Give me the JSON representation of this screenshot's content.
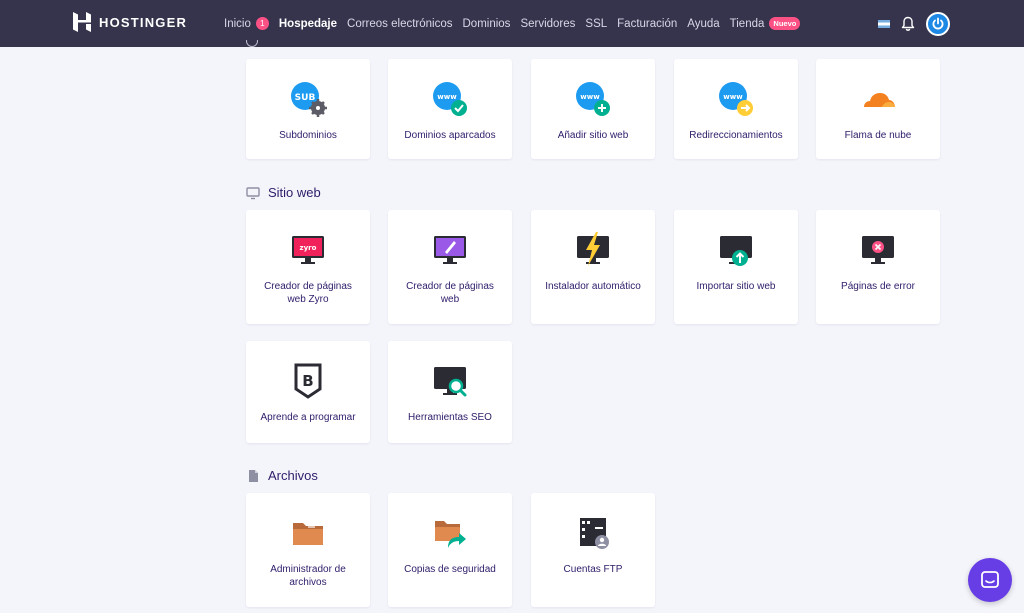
{
  "brand": {
    "name": "HOSTINGER"
  },
  "nav": {
    "items": [
      {
        "label": "Inicio",
        "badge": "1"
      },
      {
        "label": "Hospedaje",
        "active": true
      },
      {
        "label": "Correos electrónicos"
      },
      {
        "label": "Dominios"
      },
      {
        "label": "Servidores"
      },
      {
        "label": "SSL"
      },
      {
        "label": "Facturación"
      },
      {
        "label": "Ayuda"
      },
      {
        "label": "Tienda",
        "tag": "Nuevo"
      }
    ]
  },
  "sections": {
    "dominios": {
      "cards": [
        {
          "label": "Subdominios",
          "icon": "subdomain-icon"
        },
        {
          "label": "Dominios aparcados",
          "icon": "parked-domain-icon"
        },
        {
          "label": "Añadir sitio web",
          "icon": "add-website-icon"
        },
        {
          "label": "Redireccionamientos",
          "icon": "redirect-icon"
        },
        {
          "label": "Flama de nube",
          "icon": "cloudflare-icon"
        }
      ]
    },
    "sitio_web": {
      "title": "Sitio web",
      "cards": [
        {
          "label": "Creador de páginas web Zyro",
          "icon": "zyro-builder-icon",
          "logo_text": "zyro"
        },
        {
          "label": "Creador de páginas web",
          "icon": "website-builder-icon"
        },
        {
          "label": "Instalador automático",
          "icon": "auto-installer-icon"
        },
        {
          "label": "Importar sitio web",
          "icon": "import-website-icon"
        },
        {
          "label": "Páginas de error",
          "icon": "error-pages-icon"
        },
        {
          "label": "Aprende a programar",
          "icon": "learn-code-icon"
        },
        {
          "label": "Herramientas SEO",
          "icon": "seo-tools-icon"
        }
      ]
    },
    "archivos": {
      "title": "Archivos",
      "cards": [
        {
          "label": "Administrador de archivos",
          "icon": "file-manager-icon"
        },
        {
          "label": "Copias de seguridad",
          "icon": "backups-icon"
        },
        {
          "label": "Cuentas FTP",
          "icon": "ftp-accounts-icon"
        }
      ]
    }
  },
  "colors": {
    "topbar": "#36344d",
    "accent_pink": "#fc5185",
    "accent_purple": "#673de6",
    "text": "#2f1c6a",
    "background": "#f4f5fb"
  }
}
